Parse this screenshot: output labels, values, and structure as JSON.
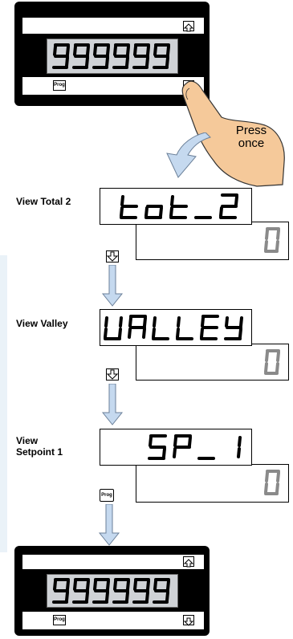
{
  "top_meter": {
    "display_value": "999999",
    "prog_label": "Prog"
  },
  "hand_callout": "Press once",
  "steps": [
    {
      "label_lines": [
        "View Total 2"
      ],
      "upper_text": "tot_2",
      "lower_value": "0",
      "advance_key": "down-arrow"
    },
    {
      "label_lines": [
        "View Valley"
      ],
      "upper_text": "VALLEY",
      "lower_value": "0",
      "advance_key": "down-arrow"
    },
    {
      "label_lines": [
        "View",
        "Setpoint 1"
      ],
      "upper_text": "SP_1",
      "lower_value": "0",
      "advance_key": "Prog"
    }
  ],
  "bottom_meter": {
    "display_value": "999999",
    "prog_label": "Prog"
  },
  "small_prog_label": "Prog",
  "colors": {
    "meter_body": "#000000",
    "lcd": "#cfd2d6",
    "digit": "#000000",
    "lower_digit": "#8a8a8a",
    "arrow": "#c5d9ef",
    "hand": "#f5c99a"
  }
}
